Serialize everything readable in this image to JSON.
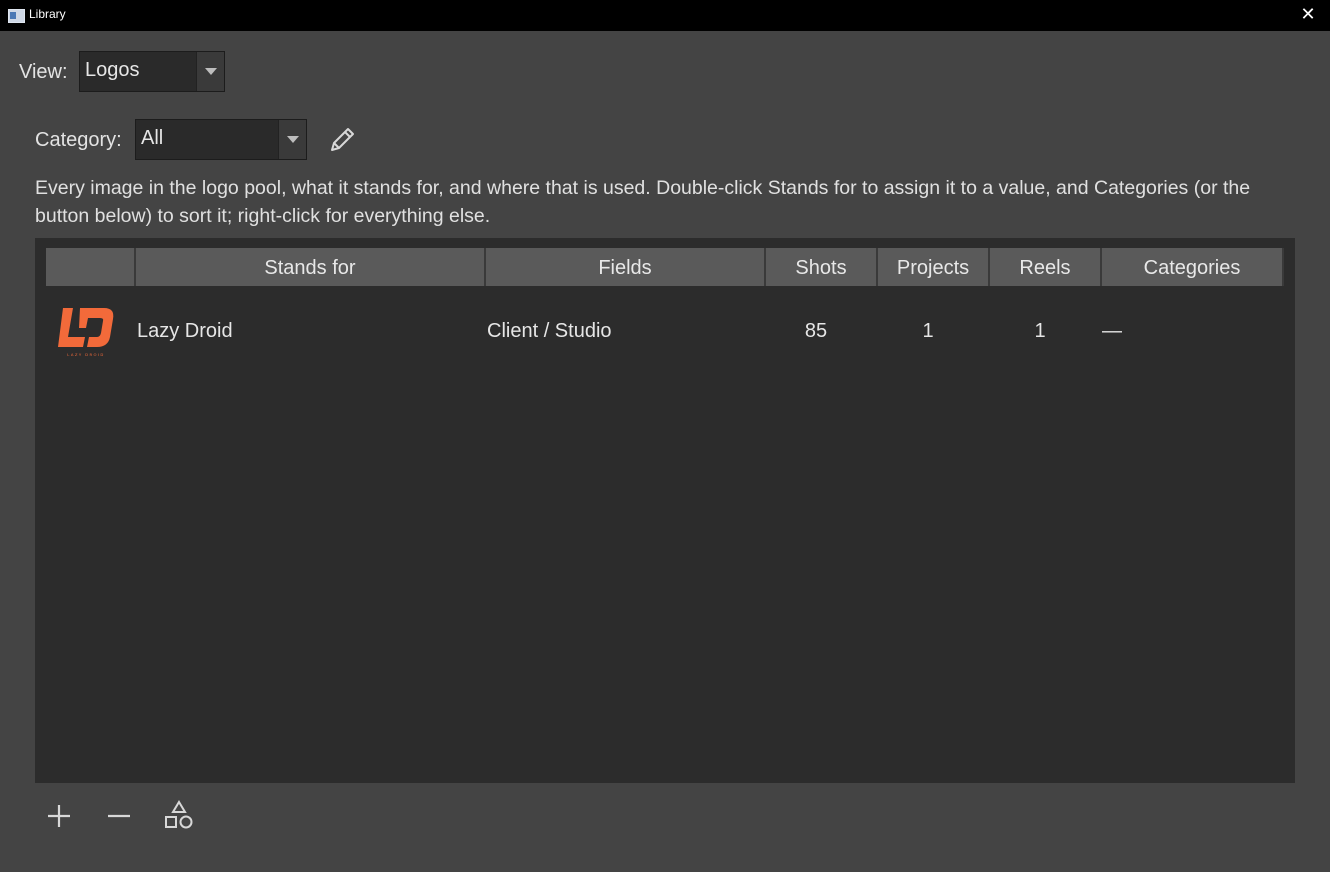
{
  "window": {
    "title": "Library"
  },
  "view": {
    "label": "View:",
    "value": "Logos"
  },
  "category": {
    "label": "Category:",
    "value": "All"
  },
  "description": "Every image in the logo pool, what it stands for, and where that is used. Double-click Stands for to assign it to a value, and Categories (or the button below) to sort it; right-click for everything else.",
  "table": {
    "columns": [
      "",
      "Stands for",
      "Fields",
      "Shots",
      "Projects",
      "Reels",
      "Categories"
    ],
    "rows": [
      {
        "stands_for": "Lazy Droid",
        "fields": "Client / Studio",
        "shots": "85",
        "projects": "1",
        "reels": "1",
        "categories": "—",
        "logo_text": "LAZY DROID"
      }
    ]
  },
  "colors": {
    "accent": "#f26a3a"
  },
  "icons": {
    "close": "close-icon",
    "edit": "pencil-icon",
    "add": "plus-icon",
    "remove": "minus-icon",
    "categorize": "shapes-icon"
  }
}
